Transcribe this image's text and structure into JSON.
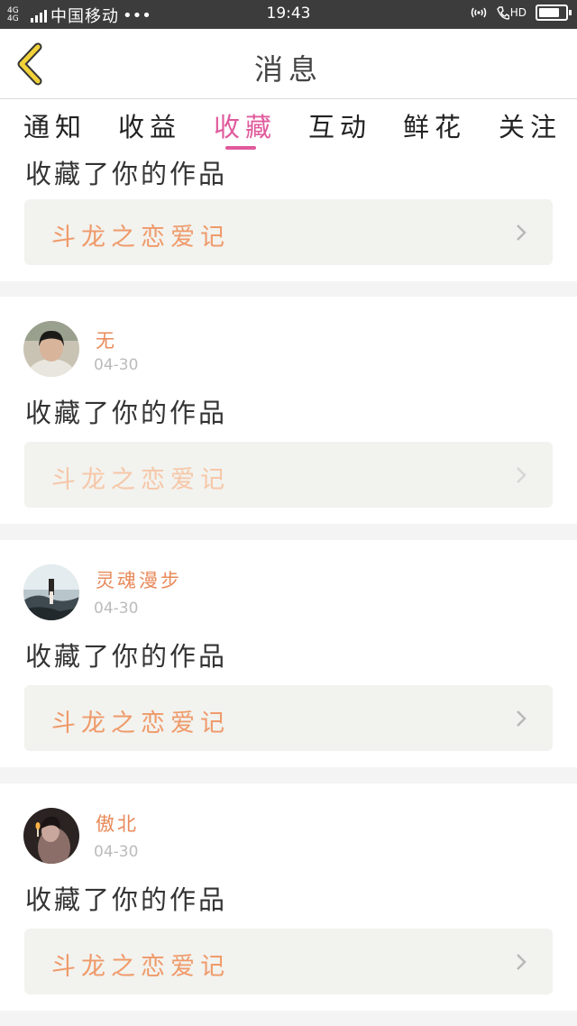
{
  "status_bar": {
    "network": "4G 4G",
    "carrier": "中国移动",
    "dots": "•••",
    "time": "19:43",
    "volte": "HD"
  },
  "header": {
    "title": "消息"
  },
  "tabs": [
    {
      "label": "通知"
    },
    {
      "label": "收益"
    },
    {
      "label": "收藏"
    },
    {
      "label": "互动"
    },
    {
      "label": "鲜花"
    },
    {
      "label": "关注"
    }
  ],
  "active_tab": "收藏",
  "feed": [
    {
      "action": "收藏了你的作品",
      "work_title": "斗龙之恋爱记"
    },
    {
      "user": "无",
      "date": "04-30",
      "action": "收藏了你的作品",
      "work_title": "斗龙之恋爱记"
    },
    {
      "user": "灵魂漫步",
      "date": "04-30",
      "action": "收藏了你的作品",
      "work_title": "斗龙之恋爱记"
    },
    {
      "user": "傲北",
      "date": "04-30",
      "action": "收藏了你的作品",
      "work_title": "斗龙之恋爱记"
    }
  ],
  "colors": {
    "accent_pink": "#e05a9c",
    "work_title_orange": "#ef9a6a",
    "back_chevron_yellow": "#f2d23a"
  }
}
